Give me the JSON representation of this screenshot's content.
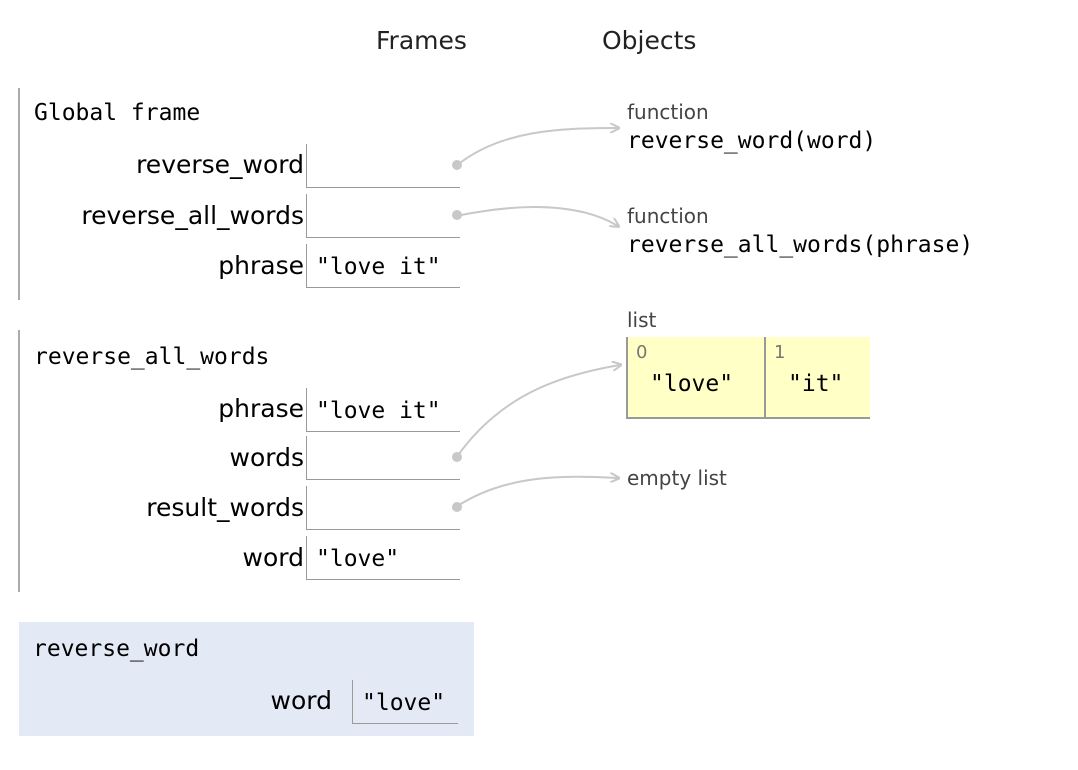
{
  "headers": {
    "frames": "Frames",
    "objects": "Objects"
  },
  "frames": [
    {
      "title": "Global frame",
      "vars": [
        {
          "name": "reverse_word",
          "value": ""
        },
        {
          "name": "reverse_all_words",
          "value": ""
        },
        {
          "name": "phrase",
          "value": "\"love it\""
        }
      ]
    },
    {
      "title": "reverse_all_words",
      "vars": [
        {
          "name": "phrase",
          "value": "\"love it\""
        },
        {
          "name": "words",
          "value": ""
        },
        {
          "name": "result_words",
          "value": ""
        },
        {
          "name": "word",
          "value": "\"love\""
        }
      ]
    },
    {
      "title": "reverse_word",
      "active": true,
      "vars": [
        {
          "name": "word",
          "value": "\"love\""
        }
      ]
    }
  ],
  "objects": {
    "func1": {
      "type": "function",
      "signature": "reverse_word(word)"
    },
    "func2": {
      "type": "function",
      "signature": "reverse_all_words(phrase)"
    },
    "list": {
      "type": "list",
      "items": [
        {
          "index": "0",
          "value": "\"love\""
        },
        {
          "index": "1",
          "value": "\"it\""
        }
      ]
    },
    "empty_list": {
      "type": "empty list"
    }
  },
  "colors": {
    "active_frame_bg": "#e3eaf6",
    "list_cell_bg": "#ffffc6",
    "arrow": "#c8c8c8"
  }
}
